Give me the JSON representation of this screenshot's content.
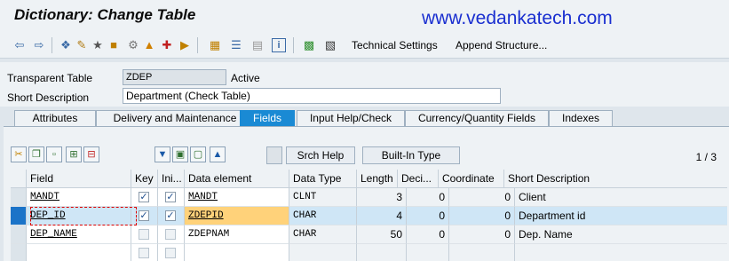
{
  "window": {
    "title": "Dictionary: Change Table",
    "watermark": "www.vedankatech.com"
  },
  "toolbar": {
    "icons": [
      "back-icon",
      "forward-icon",
      "other-object-icon",
      "display-change-icon",
      "activate-icon",
      "check-icon",
      "where-used-icon",
      "navigation-icon",
      "object-list-icon",
      "hierarchy-icon",
      "layout-icon",
      "info-icon",
      "tree-icon",
      "table-contents-icon"
    ],
    "technical_settings": "Technical Settings",
    "append_structure": "Append Structure..."
  },
  "header": {
    "table_type_label": "Transparent Table",
    "table_name": "ZDEP",
    "status": "Active",
    "short_desc_label": "Short Description",
    "short_desc": "Department (Check Table)"
  },
  "tabs": [
    "Attributes",
    "Delivery and Maintenance",
    "Fields",
    "Input Help/Check",
    "Currency/Quantity Fields",
    "Indexes"
  ],
  "active_tab": "Fields",
  "fields_panel": {
    "srch_help": "Srch Help",
    "builtin_type": "Built-In Type",
    "pager": "1 / 3",
    "columns": [
      "Field",
      "Key",
      "Ini...",
      "Data element",
      "Data Type",
      "Length",
      "Deci...",
      "Coordinate",
      "Short Description"
    ],
    "rows": [
      {
        "field": "MANDT",
        "key": true,
        "ini": true,
        "data_element": "MANDT",
        "data_type": "CLNT",
        "length": "3",
        "decimals": "0",
        "coordinate": "0",
        "short_description": "Client"
      },
      {
        "field": "DEP_ID",
        "key": true,
        "ini": true,
        "data_element": "ZDEPID",
        "data_type": "CHAR",
        "length": "4",
        "decimals": "0",
        "coordinate": "0",
        "short_description": "Department id"
      },
      {
        "field": "DEP_NAME",
        "key": false,
        "ini": false,
        "data_element": "ZDEPNAM",
        "data_type": "CHAR",
        "length": "50",
        "decimals": "0",
        "coordinate": "0",
        "short_description": "Dep. Name"
      }
    ],
    "selected_row": 1
  },
  "colors": {
    "active_tab": "#1a8ad4",
    "selection": "#1a73c8",
    "highlight_cell": "#ffd27a",
    "watermark": "#1a2fd0"
  }
}
